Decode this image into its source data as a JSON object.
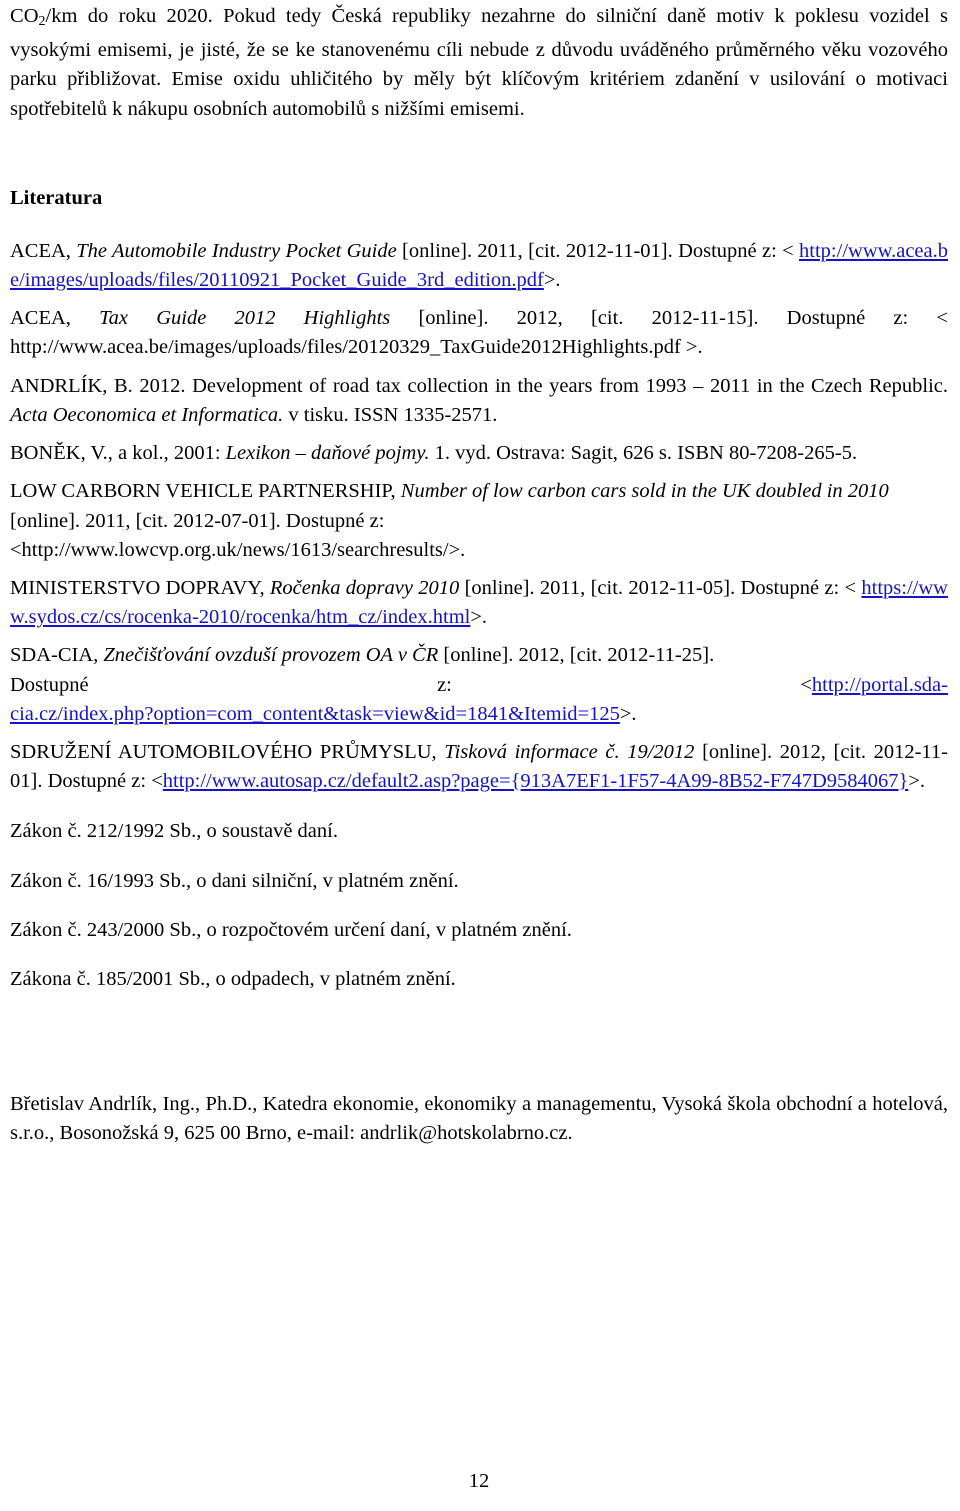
{
  "document": {
    "page_number": "12",
    "intro_paragraph": {
      "prefix": "CO",
      "subscript": "2",
      "body": "/km do roku 2020. Pokud tedy Česká republiky nezahrne do silniční daně motiv k poklesu vozidel s vysokými emisemi, je jisté, že se ke stanovenému cíli nebude z důvodu uváděného průměrného věku vozového parku přibližovat. Emise oxidu uhličitého by měly být klíčovým kritériem zdanění v usilování o motivaci spotřebitelů k nákupu osobních automobilů s nižšími emisemi."
    },
    "literature_heading": "Literatura",
    "references": {
      "acea_pocket_guide": {
        "author": "ACEA, ",
        "title": "The Automobile Industry Pocket Guide",
        "meta": " [online]. 2011, [cit. 2012-11-01]. Dostupné z: < ",
        "url": "http://www.acea.be/images/uploads/files/20110921_Pocket_Guide_3rd_edition.pdf",
        "tail": ">."
      },
      "acea_tax_guide": {
        "author": "ACEA, ",
        "title": "Tax Guide 2012 Highlights",
        "meta": " [online]. 2012, [cit. 2012-11-15]. Dostupné z: < ",
        "url": "http://www.acea.be/images/uploads/files/20120329_TaxGuide2012Highlights.pdf",
        "tail": " >."
      },
      "andrlik": {
        "author": "ANDRLÍK, B. 2012. Development of road tax collection in the years from 1993 – 2011 in the Czech Republic. ",
        "title": "Acta Oeconomica et Informatica.",
        "meta": " v tisku. ISSN 1335-2571."
      },
      "bonek": {
        "author": "BONĚK, V., a kol., 2001: ",
        "title": "Lexikon – daňové pojmy.",
        "meta": " 1. vyd. Ostrava: Sagit, 626 s. ISBN 80-7208-265-5."
      },
      "lowcvp": {
        "author": "LOW CARBORN VEHICLE PARTNERSHIP, ",
        "title": "Number of low carbon cars sold in the UK doubled in 2010",
        "meta": " [online]. 2011, [cit. 2012-07-01]. Dostupné z:",
        "url": "<http://www.lowcvp.org.uk/news/1613/searchresults/>."
      },
      "ministerstvo_dopravy": {
        "author": "MINISTERSTVO DOPRAVY, ",
        "title": "Ročenka dopravy 2010",
        "meta": " [online]. 2011, [cit. 2012-11-05]. Dostupné z: < ",
        "url": "https://www.sydos.cz/cs/rocenka-2010/rocenka/htm_cz/index.html",
        "tail": ">."
      },
      "sda_cia": {
        "author": "SDA-CIA, ",
        "title": "Znečišťování ovzduší provozem OA v ČR",
        "meta": " [online]. 2012, [cit. 2012-11-25].",
        "line2_left": "Dostupné",
        "line2_mid": "z:",
        "line2_right_prefix": "<",
        "url_part1": "http://portal.sda-",
        "url_part2": "cia.cz/index.php?option=com_content&task=view&id=1841&Itemid=125",
        "tail": ">."
      },
      "sdruzeni": {
        "author": "SDRUŽENÍ AUTOMOBILOVÉHO PRŮMYSLU, ",
        "title": "Tisková informace č. 19/2012",
        "meta": " [online]. 2012, [cit. 2012-11-01]. Dostupné z: <",
        "url_part1": "http://www.autosap.cz/default2.asp?page={913A7EF1-",
        "url_part2": "1F57-4A99-8B52-F747D9584067}",
        "tail": ">."
      }
    },
    "laws": [
      "Zákon č. 212/1992 Sb., o soustavě daní.",
      "Zákon č. 16/1993 Sb., o dani silniční, v platném znění.",
      "Zákon č. 243/2000 Sb., o rozpočtovém určení daní, v platném znění.",
      "Zákona č. 185/2001 Sb., o odpadech, v platném znění."
    ],
    "author_footer": "Břetislav Andrlík, Ing., Ph.D., Katedra ekonomie, ekonomiky a managementu, Vysoká škola obchodní a hotelová, s.r.o., Bosonožská 9, 625 00 Brno, e-mail: andrlik@hotskolabrno.cz."
  }
}
